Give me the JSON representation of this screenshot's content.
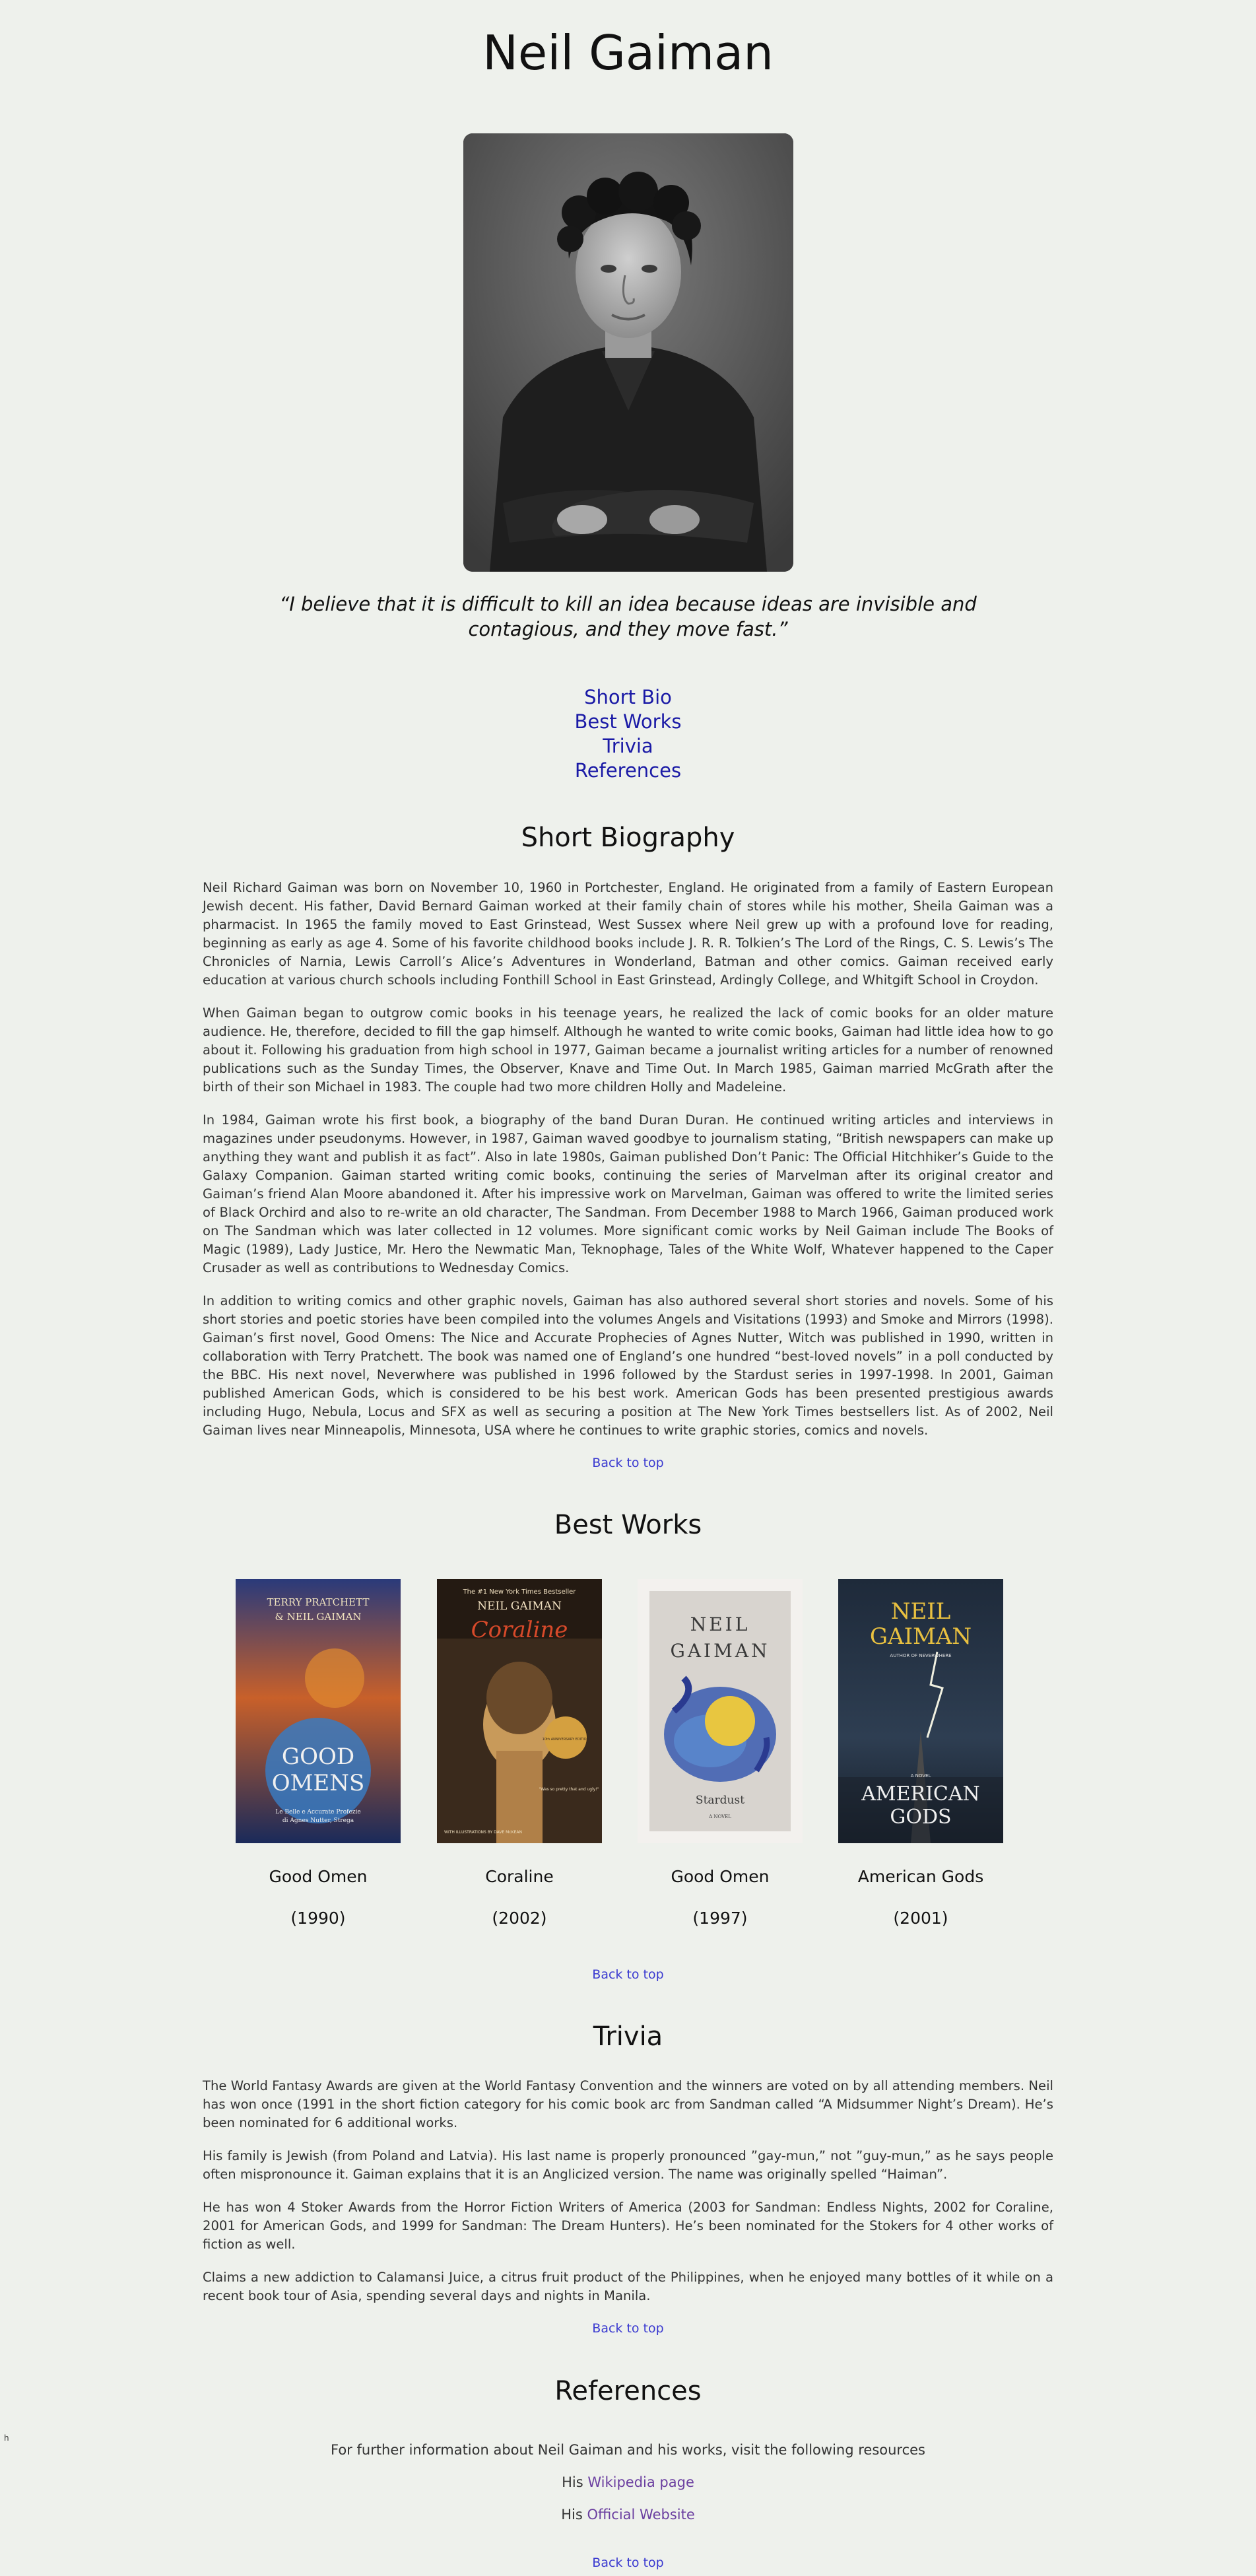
{
  "header": {
    "title": "Neil Gaiman"
  },
  "quote": "“I believe that it is difficult to kill an idea because ideas are invisible and contagious, and they move fast.”",
  "nav": {
    "short_bio": "Short Bio",
    "best_works": "Best Works",
    "trivia": "Trivia",
    "references": "References"
  },
  "bio": {
    "heading": "Short Biography",
    "paragraphs": [
      "Neil Richard Gaiman was born on November 10, 1960 in Portchester, England. He originated from a family of Eastern European Jewish decent. His father, David Bernard Gaiman worked at their family chain of stores while his mother, Sheila Gaiman was a pharmacist. In 1965 the family moved to East Grinstead, West Sussex where Neil grew up with a profound love for reading, beginning as early as age 4. Some of his favorite childhood books include J. R. R. Tolkien’s The Lord of the Rings, C. S. Lewis’s The Chronicles of Narnia, Lewis Carroll’s Alice’s Adventures in Wonderland, Batman and other comics. Gaiman received early education at various church schools including Fonthill School in East Grinstead, Ardingly College, and Whitgift School in Croydon.",
      "When Gaiman began to outgrow comic books in his teenage years, he realized the lack of comic books for an older mature audience. He, therefore, decided to fill the gap himself. Although he wanted to write comic books, Gaiman had little idea how to go about it. Following his graduation from high school in 1977, Gaiman became a journalist writing articles for a number of renowned publications such as the Sunday Times, the Observer, Knave and Time Out. In March 1985, Gaiman married McGrath after the birth of their son Michael in 1983. The couple had two more children Holly and Madeleine.",
      "In 1984, Gaiman wrote his first book, a biography of the band Duran Duran. He continued writing articles and interviews in magazines under pseudonyms. However, in 1987, Gaiman waved goodbye to journalism stating, “British newspapers can make up anything they want and publish it as fact”. Also in late 1980s, Gaiman published Don’t Panic: The Official Hitchhiker’s Guide to the Galaxy Companion. Gaiman started writing comic books, continuing the series of Marvelman after its original creator and Gaiman’s friend Alan Moore abandoned it. After his impressive work on Marvelman, Gaiman was offered to write the limited series of Black Orchird and also to re-write an old character, The Sandman. From December 1988 to March 1966, Gaiman produced work on The Sandman which was later collected in 12 volumes. More significant comic works by Neil Gaiman include The Books of Magic (1989), Lady Justice, Mr. Hero the Newmatic Man, Teknophage, Tales of the White Wolf, Whatever happened to the Caper Crusader as well as contributions to Wednesday Comics.",
      "In addition to writing comics and other graphic novels, Gaiman has also authored several short stories and novels. Some of his short stories and poetic stories have been compiled into the volumes Angels and Visitations (1993) and Smoke and Mirrors (1998). Gaiman’s first novel, Good Omens: The Nice and Accurate Prophecies of Agnes Nutter, Witch was published in 1990, written in collaboration with Terry Pratchett. The book was named one of England’s one hundred “best-loved novels” in a poll conducted by the BBC. His next novel, Neverwhere was published in 1996 followed by the Stardust series in 1997-1998. In 2001, Gaiman published American Gods, which is considered to be his best work. American Gods has been presented prestigious awards including Hugo, Nebula, Locus and SFX as well as securing a position at The New York Times bestsellers list. As of 2002, Neil Gaiman lives near Minneapolis, Minnesota, USA where he continues to write graphic stories, comics and novels."
    ]
  },
  "back_to_top": "Back to top",
  "works": {
    "heading": "Best Works",
    "books": [
      {
        "title": "Good Omen",
        "year": "(1990)",
        "cover_text": [
          "TERRY PRATCHETT",
          "& NEIL GAIMAN",
          "GOOD",
          "OMENS",
          "Le Belle e Accurate Profezie",
          "di Agnes Nutter, Strega"
        ]
      },
      {
        "title": "Coraline",
        "year": "(2002)",
        "cover_text": [
          "The #1 New York Times Bestseller",
          "NEIL GAIMAN",
          "Coraline",
          "10th ANNIVERSARY EDITION",
          "\"Was so pretty that and ugly!\"",
          "WITH ILLUSTRATIONS BY DAVE McKEAN"
        ]
      },
      {
        "title": "Good Omen",
        "year": "(1997)",
        "cover_text": [
          "NEIL",
          "GAIMAN",
          "Stardust",
          "A NOVEL"
        ]
      },
      {
        "title": "American Gods",
        "year": "(2001)",
        "cover_text": [
          "NEIL",
          "GAIMAN",
          "AUTHOR OF NEVERWHERE",
          "A NOVEL",
          "AMERICAN",
          "GODS"
        ]
      }
    ]
  },
  "trivia": {
    "heading": "Trivia",
    "paragraphs": [
      "The World Fantasy Awards are given at the World Fantasy Convention and the winners are voted on by all attending members. Neil has won once (1991 in the short fiction category for his comic book arc from Sandman called “A Midsummer Night’s Dream). He’s been nominated for 6 additional works.",
      "His family is Jewish (from Poland and Latvia). His last name is properly pronounced ”gay-mun,” not ”guy-mun,” as he says people often mispronounce it. Gaiman explains that it is an Anglicized version. The name was originally spelled “Haiman”.",
      "He has won 4 Stoker Awards from the Horror Fiction Writers of America (2003 for Sandman: Endless Nights, 2002 for Coraline, 2001 for American Gods, and 1999 for Sandman: The Dream Hunters). He’s been nominated for the Stokers for 4 other works of fiction as well.",
      "Claims a new addiction to Calamansi Juice, a citrus fruit product of the Philippines, when he enjoyed many bottles of it while on a recent book tour of Asia, spending several days and nights in Manila."
    ]
  },
  "references": {
    "heading": "References",
    "intro": "For further information about Neil Gaiman and his works, visit the following resources",
    "his": "His",
    "wiki_link": "Wikipedia page",
    "site_link": "Official Website"
  },
  "side_mark": "h"
}
